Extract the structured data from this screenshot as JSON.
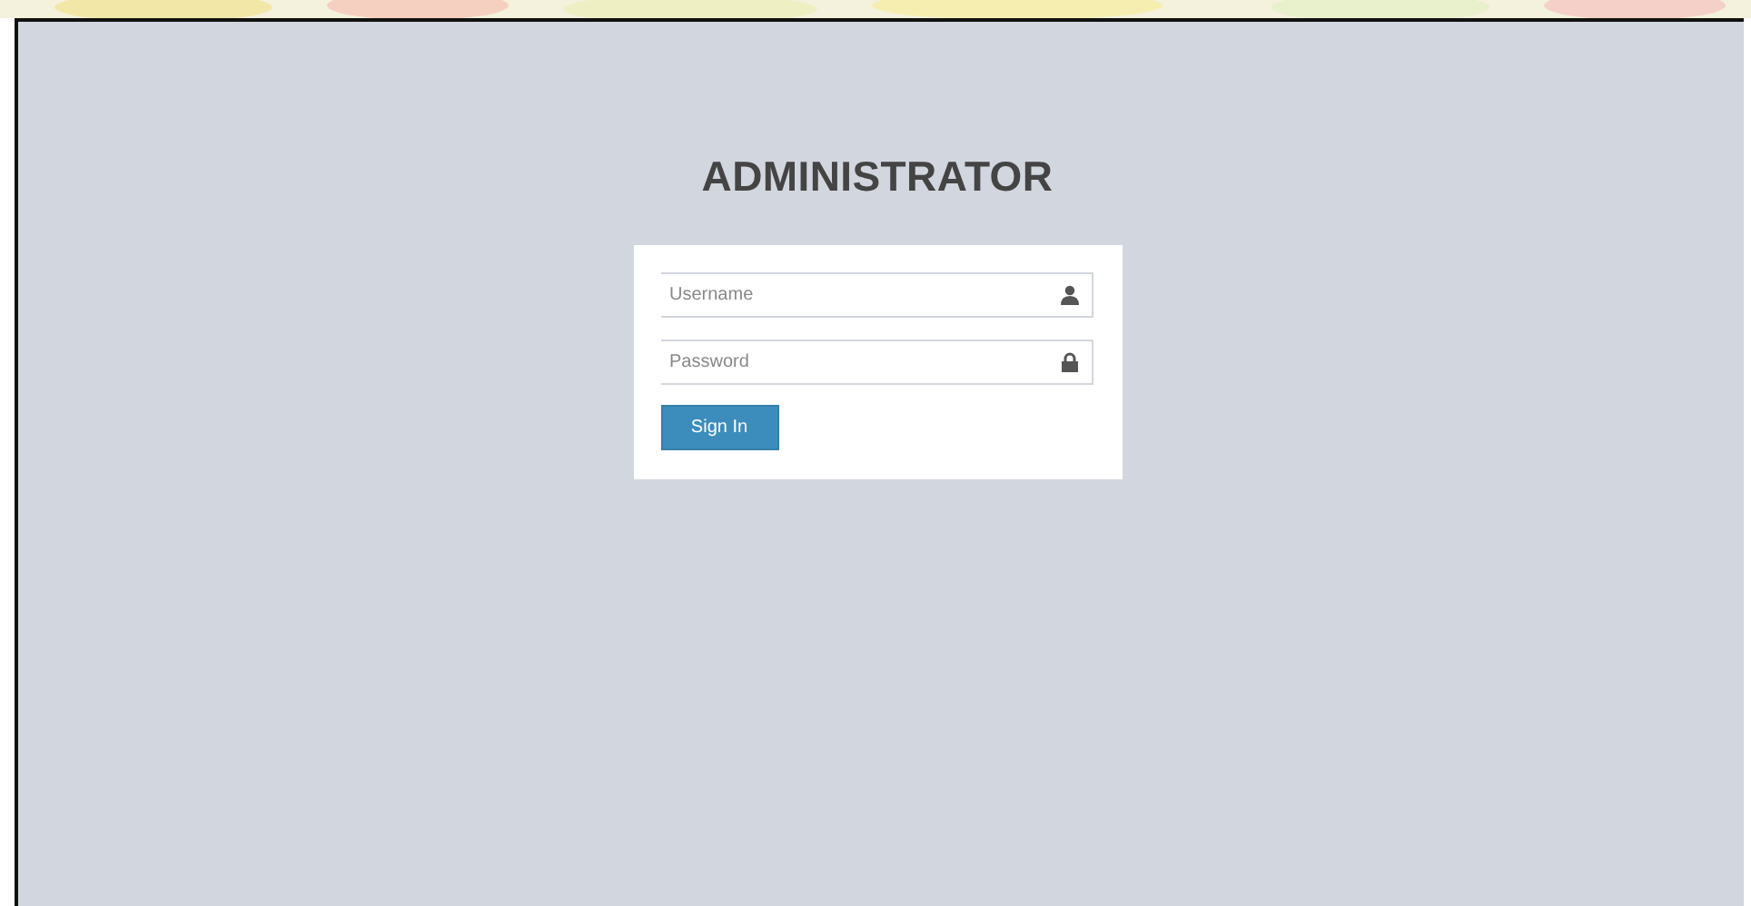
{
  "title": "ADMINISTRATOR",
  "fields": [
    {
      "kind": "text",
      "placeholder": "Username"
    },
    {
      "kind": "password",
      "placeholder": "Password"
    }
  ],
  "button": "Sign In"
}
